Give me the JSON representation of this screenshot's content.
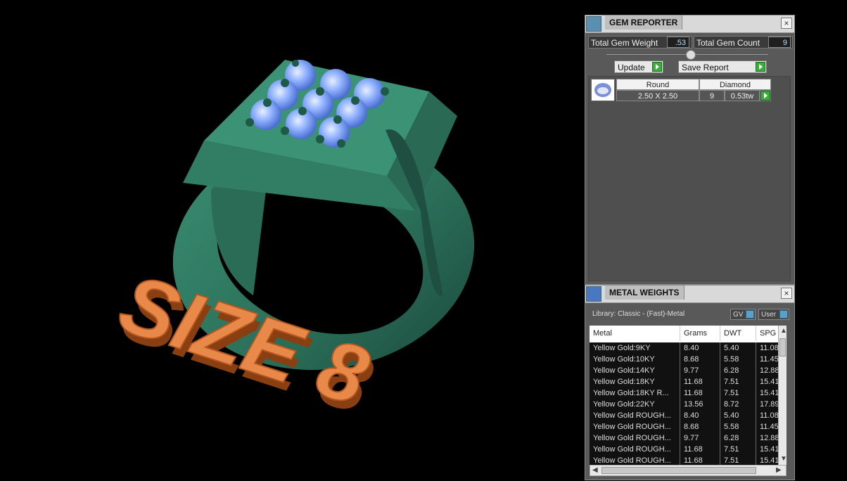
{
  "viewport": {
    "overlay_text": "SIZE 8",
    "colors": {
      "ring": "#2f7a62",
      "gems": "#8fb4ff",
      "text_3d": "#e8894a"
    }
  },
  "gem_reporter": {
    "title": "GEM REPORTER",
    "icon": "gem-reporter-icon",
    "close": "×",
    "total_weight_label": "Total Gem Weight",
    "total_weight_value": ".53",
    "total_count_label": "Total Gem Count",
    "total_count_value": "9",
    "update_label": "Update",
    "save_report_label": "Save Report",
    "gems": [
      {
        "shape": "Round",
        "size": "2.50 X 2.50",
        "material": "Diamond",
        "count": "9",
        "weight": "0.53tw"
      }
    ]
  },
  "metal_weights": {
    "title": "METAL WEIGHTS",
    "icon": "metal-weights-icon",
    "close": "×",
    "library": "Library: Classic - (Fast)-Metal",
    "gv_label": "GV",
    "user_label": "User",
    "columns": [
      "Metal",
      "Grams",
      "DWT",
      "SPG"
    ],
    "rows": [
      [
        "Yellow Gold:9KY",
        "8.40",
        "5.40",
        "11.08"
      ],
      [
        "Yellow Gold:10KY",
        "8.68",
        "5.58",
        "11.45"
      ],
      [
        "Yellow Gold:14KY",
        "9.77",
        "6.28",
        "12.88"
      ],
      [
        "Yellow Gold:18KY",
        "11.68",
        "7.51",
        "15.41"
      ],
      [
        "Yellow Gold:18KY R...",
        "11.68",
        "7.51",
        "15.41"
      ],
      [
        "Yellow Gold:22KY",
        "13.56",
        "8.72",
        "17.89"
      ],
      [
        "Yellow Gold ROUGH...",
        "8.40",
        "5.40",
        "11.08"
      ],
      [
        "Yellow Gold ROUGH...",
        "8.68",
        "5.58",
        "11.45"
      ],
      [
        "Yellow Gold ROUGH...",
        "9.77",
        "6.28",
        "12.88"
      ],
      [
        "Yellow Gold ROUGH...",
        "11.68",
        "7.51",
        "15.41"
      ],
      [
        "Yellow Gold ROUGH...",
        "11.68",
        "7.51",
        "15.41"
      ]
    ]
  }
}
